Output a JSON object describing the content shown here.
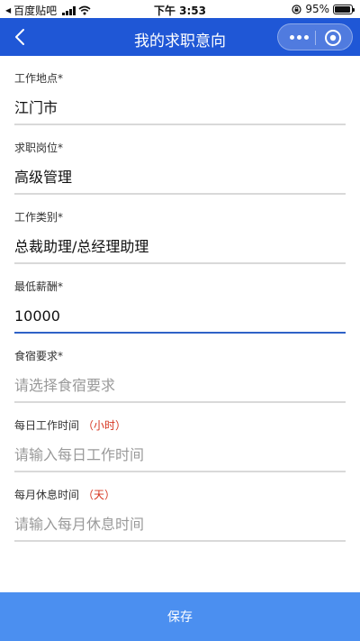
{
  "status_bar": {
    "back_app": "百度贴吧",
    "time": "下午 3:53",
    "battery": "95%",
    "battery_level": 0.95
  },
  "nav": {
    "title": "我的求职意向",
    "back_icon": "chevron-left-icon",
    "more_icon": "more-dots-icon",
    "close_icon": "target-close-icon",
    "color": "#1f57d6"
  },
  "form": {
    "fields": [
      {
        "label": "工作地点*",
        "hint": "",
        "value": "江门市",
        "placeholder": ""
      },
      {
        "label": "求职岗位*",
        "hint": "",
        "value": "高级管理",
        "placeholder": ""
      },
      {
        "label": "工作类别*",
        "hint": "",
        "value": "总裁助理/总经理助理",
        "placeholder": ""
      },
      {
        "label": "最低薪酬*",
        "hint": "",
        "value": "10000",
        "placeholder": ""
      },
      {
        "label": "食宿要求*",
        "hint": "",
        "value": "",
        "placeholder": "请选择食宿要求"
      },
      {
        "label": "每日工作时间",
        "hint": "（小时）",
        "value": "",
        "placeholder": "请输入每日工作时间"
      },
      {
        "label": "每月休息时间",
        "hint": "（天）",
        "value": "",
        "placeholder": "请输入每月休息时间"
      }
    ]
  },
  "footer": {
    "save_label": "保存",
    "color": "#4b8ff0"
  }
}
